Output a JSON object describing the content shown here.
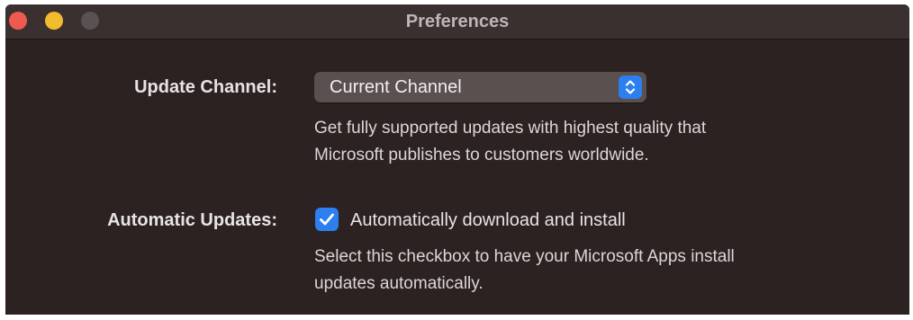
{
  "window": {
    "title": "Preferences"
  },
  "update_channel": {
    "label": "Update Channel:",
    "selected": "Current Channel",
    "description_line1": "Get fully supported updates with highest quality that",
    "description_line2": "Microsoft publishes to customers worldwide."
  },
  "automatic_updates": {
    "label": "Automatic Updates:",
    "checkbox_label": "Automatically download and install",
    "checked": true,
    "description_line1": "Select this checkbox to have your Microsoft Apps install",
    "description_line2": "updates automatically."
  },
  "colors": {
    "accent": "#2d7ff0",
    "background": "#2c2222",
    "close": "#ee5a52",
    "minimize": "#f3bb2e",
    "zoom_disabled": "#5a5152"
  },
  "icons": {
    "stepper": "chevron-up-down-icon",
    "checkmark": "checkmark-icon"
  }
}
